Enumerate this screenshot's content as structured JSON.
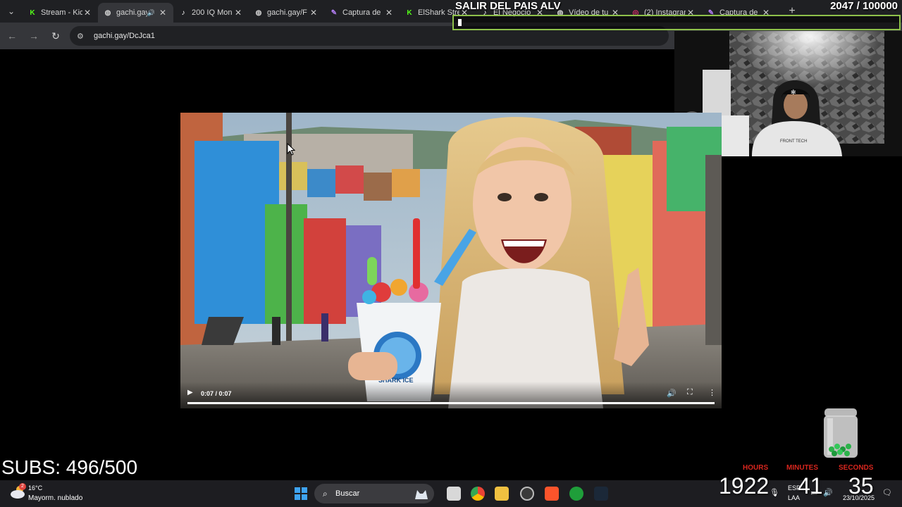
{
  "browser": {
    "tabs": [
      {
        "title": "Stream - Kick",
        "favicon": "kick-icon"
      },
      {
        "title": "gachi.gay",
        "favicon": "globe-icon",
        "active": true
      },
      {
        "title": "200 IQ Mon",
        "favicon": "tiktok-icon"
      },
      {
        "title": "gachi.gay/F",
        "favicon": "globe-icon"
      },
      {
        "title": "Captura de",
        "favicon": "pen-icon"
      },
      {
        "title": "ElShark Stre",
        "favicon": "kick-icon"
      },
      {
        "title": "El Negocio",
        "favicon": "tiktok-icon"
      },
      {
        "title": "Vídeo de tu",
        "favicon": "globe-icon"
      },
      {
        "title": "(2) Instagram",
        "favicon": "instagram-icon"
      },
      {
        "title": "Captura de",
        "favicon": "pen-icon"
      }
    ],
    "address": "gachi.gay/DcJca1"
  },
  "overlay": {
    "title": "SALIR DEL PAIS ALV",
    "count": "2047",
    "goal": "/ 100000"
  },
  "video": {
    "time": "0:07 / 0:07",
    "progress": 1.0,
    "cup_text": "SHARK ICE"
  },
  "subs": "SUBS: 496/500",
  "countdown": {
    "hours_label": "HOURS",
    "minutes_label": "MINUTES",
    "seconds_label": "SECONDS",
    "hours": "1922",
    "minutes": "41",
    "seconds": "35"
  },
  "taskbar": {
    "weather_temp": "16°C",
    "weather_desc": "Mayorm. nublado",
    "weather_badge": "2",
    "search_label": "Buscar",
    "lang": "ESP",
    "lang2": "LAA",
    "date": "23/10/2025"
  },
  "colors": {
    "accent_green": "#53fc18",
    "timer_label": "#d8261e",
    "overlay_border": "#8ec14a"
  }
}
